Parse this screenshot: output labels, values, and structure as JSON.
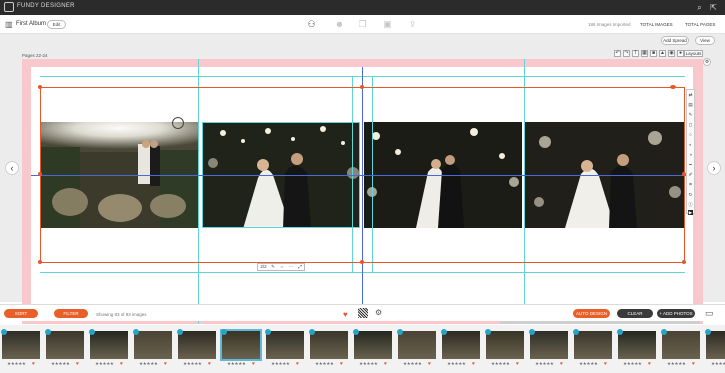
{
  "app": {
    "name": "FUNDY DESIGNER"
  },
  "header": {
    "album_title": "First Album",
    "edit_label": "Edit",
    "counters": {
      "images_imported": "186 Images Imported",
      "total_images_label": "TOTAL IMAGES",
      "total_pages_label": "TOTAL PAGES"
    }
  },
  "workspace": {
    "add_spread_label": "Add Spread",
    "view_label": "View",
    "pages_label": "Pages 22-24",
    "layouts_label": "Layouts",
    "photo_toolbar_label": "2/2",
    "cut_lines_label": "Cut Lines",
    "safe_zone_label": "Safe Zone"
  },
  "strip": {
    "sort_label": "SORT",
    "filter_label": "FILTER",
    "showing_text": "Showing 83 of 83 images",
    "auto_design_label": "AUTO DESIGN",
    "clear_label": "CLEAR",
    "add_photos_label": "+ ADD PHOTOS"
  },
  "icons": {
    "back": "back-arrow-icon",
    "forward": "forward-arrow-icon",
    "heart": "heart-icon",
    "star": "star-icon"
  },
  "colors": {
    "accent": "#e85f29",
    "bleed": "#f9c8cc",
    "guide": "#5fd5d8",
    "selection": "#e8572b",
    "badge": "#27a3c6"
  },
  "thumbnails": [
    {
      "stars": "★★★★★"
    },
    {
      "stars": "★★★★★"
    },
    {
      "stars": "★★★★★"
    },
    {
      "stars": "★★★★★"
    },
    {
      "stars": "★★★★★"
    },
    {
      "stars": "★★★★★"
    },
    {
      "stars": "★★★★★"
    },
    {
      "stars": "★★★★★"
    },
    {
      "stars": "★★★★★"
    },
    {
      "stars": "★★★★★"
    },
    {
      "stars": "★★★★★"
    },
    {
      "stars": "★★★★★"
    },
    {
      "stars": "★★★★★"
    },
    {
      "stars": "★★★★★"
    },
    {
      "stars": "★★★★★"
    },
    {
      "stars": "★★★★★"
    },
    {
      "stars": "★★★★★"
    }
  ]
}
